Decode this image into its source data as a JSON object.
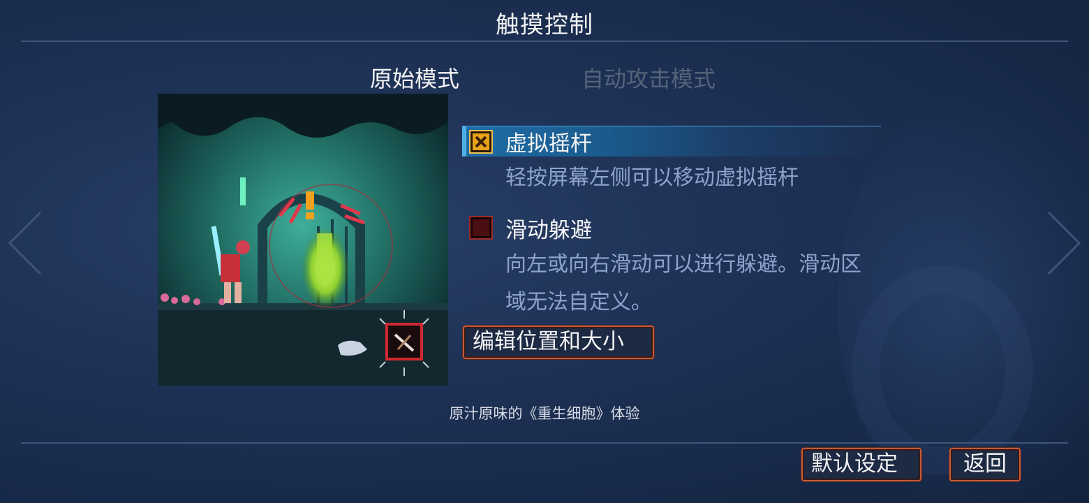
{
  "header": {
    "title": "触摸控制"
  },
  "tabs": [
    {
      "label": "原始模式",
      "active": true
    },
    {
      "label": "自动攻击模式",
      "active": false
    }
  ],
  "options": [
    {
      "label": "虚拟摇杆",
      "checked": true,
      "description": "轻按屏幕左侧可以移动虚拟摇杆"
    },
    {
      "label": "滑动躲避",
      "checked": false,
      "description_line1": "向左或向右滑动可以进行躲避。滑动区",
      "description_line2": "域无法自定义。"
    }
  ],
  "buttons": {
    "edit": "编辑位置和大小",
    "default": "默认设定",
    "back": "返回"
  },
  "caption": "原汁原味的《重生细胞》体验",
  "icons": {
    "nav_left": "chevron-left-icon",
    "nav_right": "chevron-right-icon",
    "checkbox_checked": "checkbox-checked-icon",
    "checkbox_unchecked": "checkbox-unchecked-icon",
    "skill": "crossbow-skill-icon"
  },
  "colors": {
    "selected_row": "#1f6ea8",
    "button_border": "#c45a3a",
    "checkbox_checked": "#e8a21a",
    "checkbox_unchecked": "#4a0f12",
    "inactive_tab": "#55637a"
  }
}
